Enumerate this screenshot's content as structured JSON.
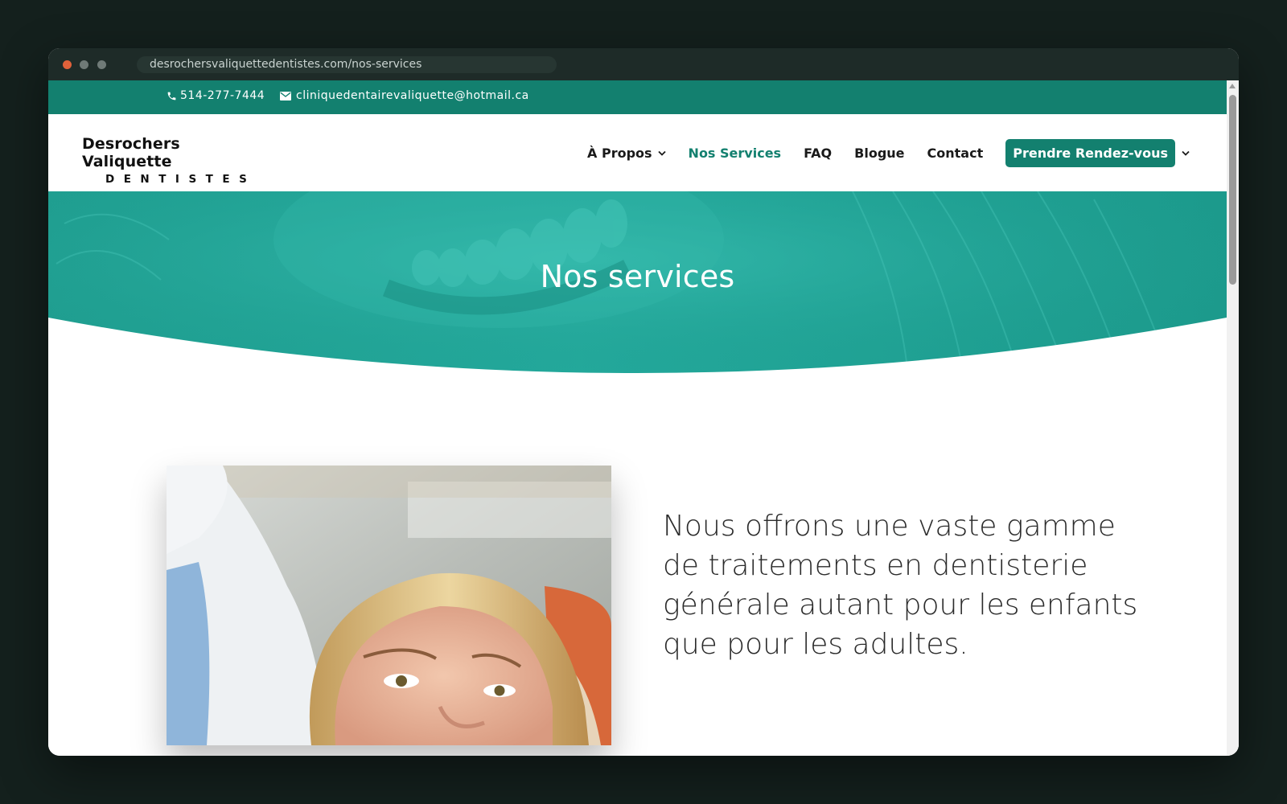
{
  "browser": {
    "url": "desrochersvaliquettedentistes.com/nos-services"
  },
  "topbar": {
    "phone": "514-277-7444",
    "phone_icon": "phone-icon",
    "email": "cliniquedentairevaliquette@hotmail.ca",
    "email_icon": "envelope-icon"
  },
  "header": {
    "logo_name": "Desrochers Valiquette",
    "logo_sub": "DENTISTES",
    "nav": {
      "a_propos": "À Propos",
      "services": "Nos Services",
      "faq": "FAQ",
      "blogue": "Blogue",
      "contact": "Contact"
    },
    "cta": "Prendre Rendez-vous"
  },
  "hero": {
    "title": "Nos services"
  },
  "intro": {
    "text": "Nous offrons une vaste gamme de traitements en dentisterie générale autant pour les enfants que pour les adultes."
  },
  "colors": {
    "brand": "#13806f",
    "hero": "#23a89b"
  }
}
